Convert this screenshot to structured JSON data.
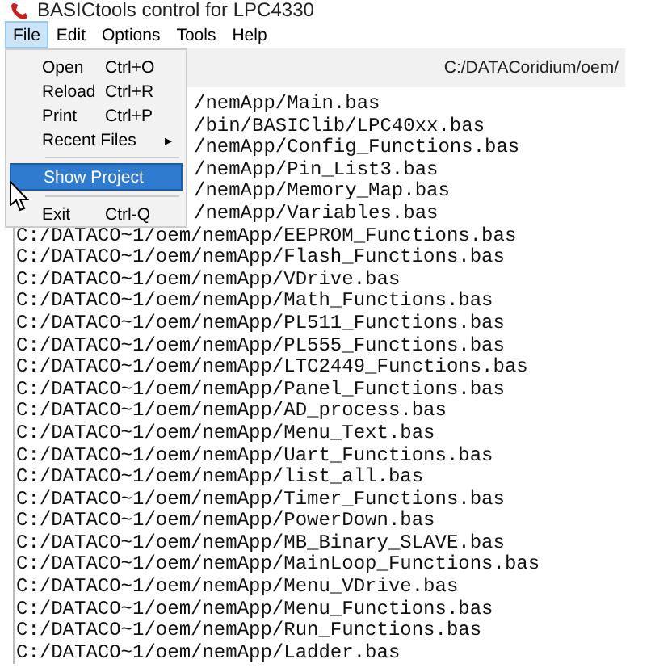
{
  "window": {
    "title": "BASICtools control for LPC4330"
  },
  "menu_bar": [
    {
      "label": "File",
      "selected": true
    },
    {
      "label": "Edit",
      "selected": false
    },
    {
      "label": "Options",
      "selected": false
    },
    {
      "label": "Tools",
      "selected": false
    },
    {
      "label": "Help",
      "selected": false
    }
  ],
  "file_menu": [
    {
      "kind": "item",
      "label": "Open",
      "shortcut": "Ctrl+O",
      "selected": false
    },
    {
      "kind": "item",
      "label": "Reload",
      "shortcut": "Ctrl+R",
      "selected": false
    },
    {
      "kind": "item",
      "label": "Print",
      "shortcut": "Ctrl+P",
      "selected": false
    },
    {
      "kind": "submenu",
      "label": "Recent Files",
      "arrow": "▸",
      "selected": false
    },
    {
      "kind": "separator"
    },
    {
      "kind": "item",
      "label": "Show Project",
      "selected": true
    },
    {
      "kind": "separator"
    },
    {
      "kind": "item",
      "label": "Exit",
      "shortcut": "Ctrl-Q",
      "selected": false
    }
  ],
  "toolbar": {
    "path": "C:/DATACoridium/oem/"
  },
  "files_behind_menu": [
    "/nemApp/Main.bas",
    "/bin/BASIClib/LPC40xx.bas",
    "/nemApp/Config_Functions.bas",
    "/nemApp/Pin_List3.bas",
    "/nemApp/Memory_Map.bas",
    "/nemApp/Variables.bas"
  ],
  "files": [
    "C:/DATACO~1/oem/nemApp/EEPROM_Functions.bas",
    "C:/DATACO~1/oem/nemApp/Flash_Functions.bas",
    "C:/DATACO~1/oem/nemApp/VDrive.bas",
    "C:/DATACO~1/oem/nemApp/Math_Functions.bas",
    "C:/DATACO~1/oem/nemApp/PL511_Functions.bas",
    "C:/DATACO~1/oem/nemApp/PL555_Functions.bas",
    "C:/DATACO~1/oem/nemApp/LTC2449_Functions.bas",
    "C:/DATACO~1/oem/nemApp/Panel_Functions.bas",
    "C:/DATACO~1/oem/nemApp/AD_process.bas",
    "C:/DATACO~1/oem/nemApp/Menu_Text.bas",
    "C:/DATACO~1/oem/nemApp/Uart_Functions.bas",
    "C:/DATACO~1/oem/nemApp/list_all.bas",
    "C:/DATACO~1/oem/nemApp/Timer_Functions.bas",
    "C:/DATACO~1/oem/nemApp/PowerDown.bas",
    "C:/DATACO~1/oem/nemApp/MB_Binary_SLAVE.bas",
    "C:/DATACO~1/oem/nemApp/MainLoop_Functions.bas",
    "C:/DATACO~1/oem/nemApp/Menu_VDrive.bas",
    "C:/DATACO~1/oem/nemApp/Menu_Functions.bas",
    "C:/DATACO~1/oem/nemApp/Run_Functions.bas",
    "C:/DATACO~1/oem/nemApp/Ladder.bas"
  ]
}
